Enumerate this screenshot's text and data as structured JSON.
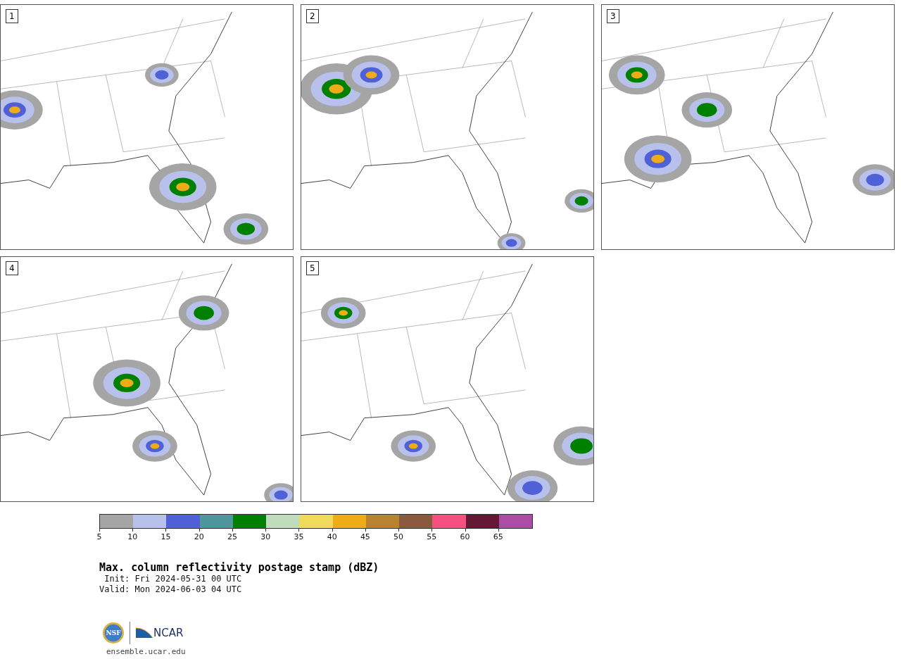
{
  "panels": [
    {
      "label": "1"
    },
    {
      "label": "2"
    },
    {
      "label": "3"
    },
    {
      "label": "4"
    },
    {
      "label": "5"
    }
  ],
  "colorbar": [
    {
      "label": "5",
      "color": "#a5a5a5"
    },
    {
      "label": "10",
      "color": "#b7c1ec"
    },
    {
      "label": "15",
      "color": "#5060d6"
    },
    {
      "label": "20",
      "color": "#4f979c"
    },
    {
      "label": "25",
      "color": "#008000"
    },
    {
      "label": "30",
      "color": "#bfdcbc"
    },
    {
      "label": "35",
      "color": "#f0da5c"
    },
    {
      "label": "40",
      "color": "#f0ac18"
    },
    {
      "label": "45",
      "color": "#b8822e"
    },
    {
      "label": "50",
      "color": "#8a5a3e"
    },
    {
      "label": "55",
      "color": "#f45080"
    },
    {
      "label": "60",
      "color": "#641834"
    },
    {
      "label": "65",
      "color": "#ac4ca4"
    }
  ],
  "title": "Max. column reflectivity postage stamp (dBZ)",
  "init": " Init: Fri 2024-05-31 00 UTC",
  "valid": "Valid: Mon 2024-06-03 04 UTC",
  "logos": {
    "nsf": "NSF",
    "ncar": "NCAR"
  },
  "site": "ensemble.ucar.edu"
}
